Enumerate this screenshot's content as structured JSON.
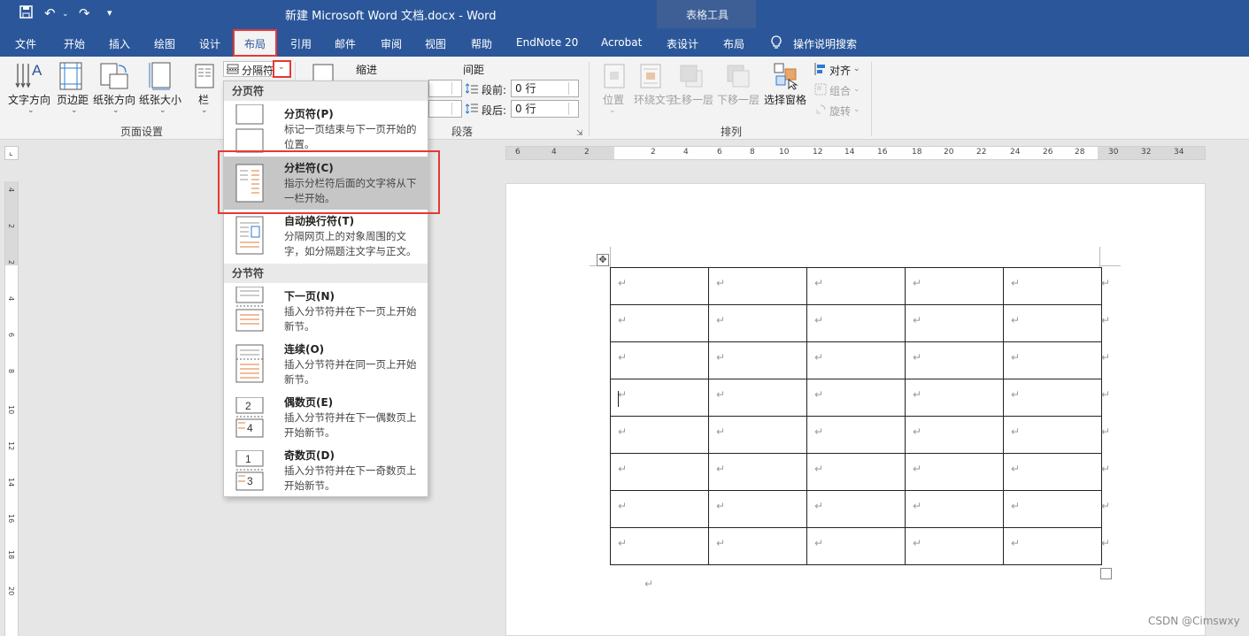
{
  "window": {
    "title": "新建 Microsoft Word 文档.docx  -  Word",
    "contextual_header": "表格工具",
    "qat": [
      "save-icon",
      "undo-icon",
      "redo-icon",
      "customize-icon"
    ]
  },
  "tabs": [
    {
      "label": "文件"
    },
    {
      "label": "开始"
    },
    {
      "label": "插入"
    },
    {
      "label": "绘图"
    },
    {
      "label": "设计"
    },
    {
      "label": "布局",
      "active": true
    },
    {
      "label": "引用"
    },
    {
      "label": "邮件"
    },
    {
      "label": "审阅"
    },
    {
      "label": "视图"
    },
    {
      "label": "帮助"
    },
    {
      "label": "EndNote 20"
    },
    {
      "label": "Acrobat"
    },
    {
      "label": "表设计"
    },
    {
      "label": "布局"
    },
    {
      "label": "操作说明搜索"
    }
  ],
  "ribbon": {
    "page_setup": {
      "buttons": [
        {
          "label": "文字方向"
        },
        {
          "label": "页边距"
        },
        {
          "label": "纸张方向"
        },
        {
          "label": "纸张大小"
        },
        {
          "label": "栏"
        }
      ],
      "breaks_button": "分隔符",
      "group_label": "页面设置"
    },
    "paragraph": {
      "indent_label": "缩进",
      "spacing_label": "间距",
      "before_label": "段前:",
      "before_value": "0 行",
      "after_label": "段后:",
      "after_value": "0 行",
      "group_label": "段落"
    },
    "arrange": {
      "buttons": [
        {
          "label": "位置"
        },
        {
          "label": "环绕文字"
        },
        {
          "label": "上移一层"
        },
        {
          "label": "下移一层"
        },
        {
          "label": "选择窗格"
        }
      ],
      "align": "对齐",
      "group": "组合",
      "rotate": "旋转",
      "group_label": "排列"
    }
  },
  "dropdown": {
    "section_page": "分页符",
    "section_section": "分节符",
    "items": [
      {
        "title": "分页符(P)",
        "desc": "标记一页结束与下一页开始的位置。"
      },
      {
        "title": "分栏符(C)",
        "desc": "指示分栏符后面的文字将从下一栏开始。",
        "highlighted": true
      },
      {
        "title": "自动换行符(T)",
        "desc": "分隔网页上的对象周围的文字，如分隔题注文字与正文。"
      },
      {
        "title": "下一页(N)",
        "desc": "插入分节符并在下一页上开始新节。"
      },
      {
        "title": "连续(O)",
        "desc": "插入分节符并在同一页上开始新节。"
      },
      {
        "title": "偶数页(E)",
        "desc": "插入分节符并在下一偶数页上开始新节。"
      },
      {
        "title": "奇数页(D)",
        "desc": "插入分节符并在下一奇数页上开始新节。"
      }
    ]
  },
  "ruler": {
    "h_ticks": [
      "6",
      "4",
      "2",
      "2",
      "4",
      "6",
      "8",
      "10",
      "12",
      "14",
      "16",
      "18",
      "20",
      "22",
      "24",
      "26",
      "28",
      "30",
      "32",
      "34"
    ],
    "v_ticks": [
      "4",
      "2",
      "2",
      "4",
      "6",
      "8",
      "10",
      "12",
      "14",
      "16",
      "18",
      "20"
    ]
  },
  "document": {
    "table": {
      "rows": 8,
      "cols": 5,
      "cell_mark": "↵"
    },
    "trailing_mark": "↵"
  },
  "watermark": "CSDN @Cimswxy",
  "colors": {
    "accent": "#2b579a",
    "highlight": "#e53935"
  }
}
